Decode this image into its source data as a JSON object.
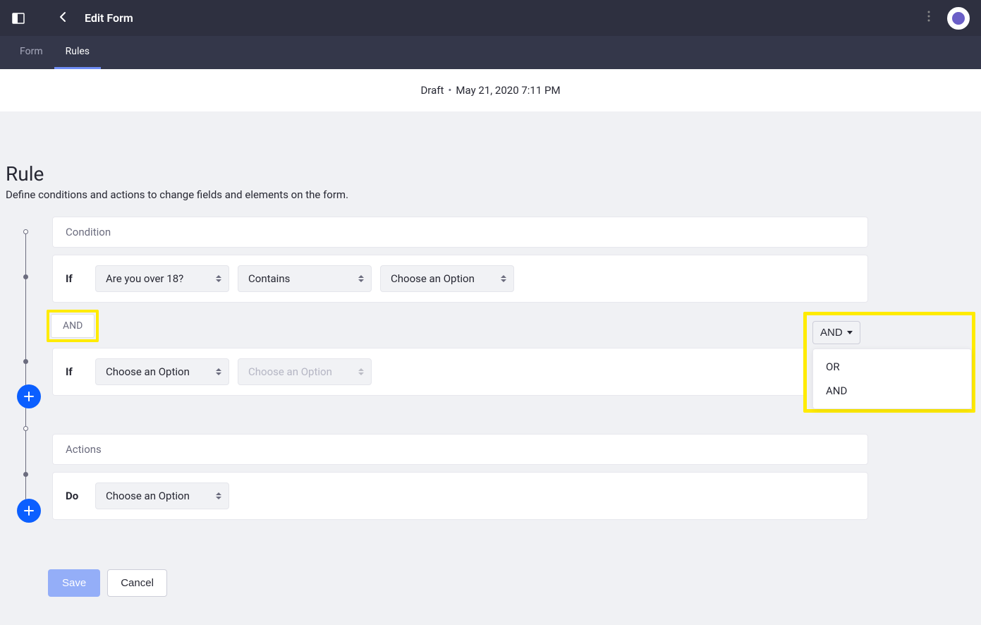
{
  "header": {
    "title": "Edit Form"
  },
  "tabs": {
    "form": "Form",
    "rules": "Rules"
  },
  "status": {
    "draft": "Draft",
    "timestamp": "May 21, 2020 7:11 PM"
  },
  "page": {
    "title": "Rule",
    "subtitle": "Define conditions and actions to change fields and elements on the form."
  },
  "sections": {
    "condition": "Condition",
    "actions": "Actions"
  },
  "labels": {
    "if": "If",
    "do": "Do"
  },
  "joiner": {
    "button": "AND",
    "caption": "AND",
    "options": {
      "or": "OR",
      "and": "AND"
    }
  },
  "condition1": {
    "field": "Are you over 18?",
    "operator": "Contains",
    "value": "Choose an Option"
  },
  "condition2": {
    "field": "Choose an Option",
    "operator": "Choose an Option"
  },
  "action1": {
    "type": "Choose an Option"
  },
  "buttons": {
    "save": "Save",
    "cancel": "Cancel"
  }
}
